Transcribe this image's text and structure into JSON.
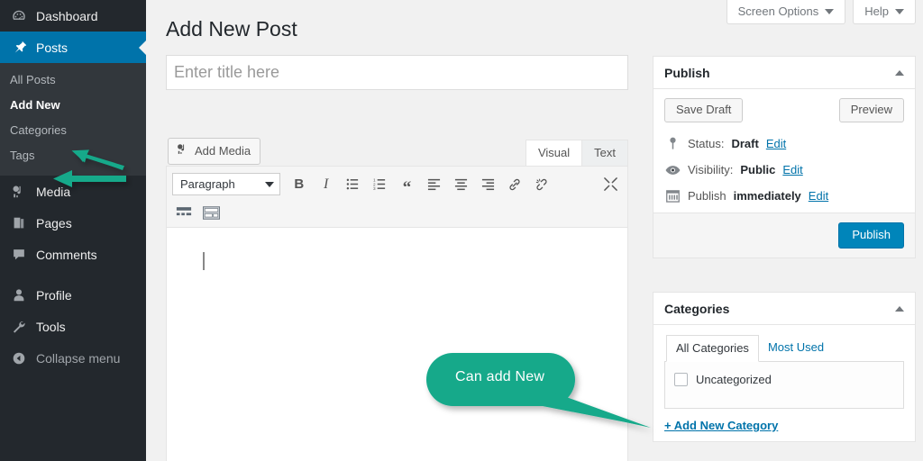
{
  "theme": {
    "sidebar_bg": "#23282d",
    "submenu_bg": "#32373c",
    "active_blue": "#0073aa",
    "primary_button": "#0085ba",
    "link_blue": "#0073aa",
    "annotation_green": "#13a98a",
    "page_bg": "#f1f1f1"
  },
  "sidebar": {
    "items": [
      {
        "label": "Dashboard",
        "icon": "dashboard-gauge-icon",
        "state": "normal"
      },
      {
        "label": "Posts",
        "icon": "pin-icon",
        "state": "current"
      },
      {
        "label": "Media",
        "icon": "media-icon",
        "state": "normal"
      },
      {
        "label": "Pages",
        "icon": "pages-icon",
        "state": "normal"
      },
      {
        "label": "Comments",
        "icon": "comment-bubble-icon",
        "state": "normal"
      },
      {
        "label": "Profile",
        "icon": "user-icon",
        "state": "normal"
      },
      {
        "label": "Tools",
        "icon": "wrench-icon",
        "state": "normal"
      },
      {
        "label": "Collapse menu",
        "icon": "collapse-left-icon",
        "state": "dim"
      }
    ],
    "posts_submenu": [
      {
        "label": "All Posts",
        "current": false
      },
      {
        "label": "Add New",
        "current": true
      },
      {
        "label": "Categories",
        "current": false
      },
      {
        "label": "Tags",
        "current": false
      }
    ]
  },
  "screen_meta": {
    "screen_options": "Screen Options",
    "help": "Help"
  },
  "main": {
    "page_title": "Add New Post",
    "title_placeholder": "Enter title here",
    "title_value": "",
    "add_media": "Add Media",
    "editor_tabs": [
      {
        "label": "Visual",
        "active": true
      },
      {
        "label": "Text",
        "active": false
      }
    ],
    "format_select": "Paragraph",
    "toolbar_row1": [
      {
        "name": "bold-icon",
        "glyph": "B"
      },
      {
        "name": "italic-icon",
        "glyph": "I"
      },
      {
        "name": "bulleted-list-icon",
        "glyph": "≣"
      },
      {
        "name": "numbered-list-icon",
        "glyph": "≣"
      },
      {
        "name": "blockquote-icon",
        "glyph": "“"
      },
      {
        "name": "align-left-icon",
        "glyph": "≡"
      },
      {
        "name": "align-center-icon",
        "glyph": "≡"
      },
      {
        "name": "align-right-icon",
        "glyph": "≡"
      },
      {
        "name": "insert-link-icon",
        "glyph": "🔗"
      },
      {
        "name": "remove-link-icon",
        "glyph": "🔗"
      },
      {
        "name": "fullscreen-icon",
        "glyph": "⤢"
      }
    ],
    "toolbar_row2": [
      {
        "name": "read-more-icon",
        "glyph": ""
      },
      {
        "name": "toolbar-toggle-icon",
        "glyph": ""
      }
    ],
    "editor_content": ""
  },
  "publish_box": {
    "title": "Publish",
    "save_draft": "Save Draft",
    "preview": "Preview",
    "status_label": "Status:",
    "status_value": "Draft",
    "status_edit": "Edit",
    "visibility_label": "Visibility:",
    "visibility_value": "Public",
    "visibility_edit": "Edit",
    "schedule_label": "Publish",
    "schedule_value": "immediately",
    "schedule_edit": "Edit",
    "publish_button": "Publish"
  },
  "categories_box": {
    "title": "Categories",
    "tabs": [
      {
        "label": "All Categories",
        "active": true
      },
      {
        "label": "Most Used",
        "active": false
      }
    ],
    "items": [
      {
        "label": "Uncategorized",
        "checked": false
      }
    ],
    "add_new_link": "+ Add New Category"
  },
  "annotations": {
    "callout_text": "Can add New",
    "arrows": [
      {
        "name": "arrow-to-categories",
        "points_to": "Categories"
      },
      {
        "name": "arrow-to-tags",
        "points_to": "Tags"
      }
    ]
  }
}
